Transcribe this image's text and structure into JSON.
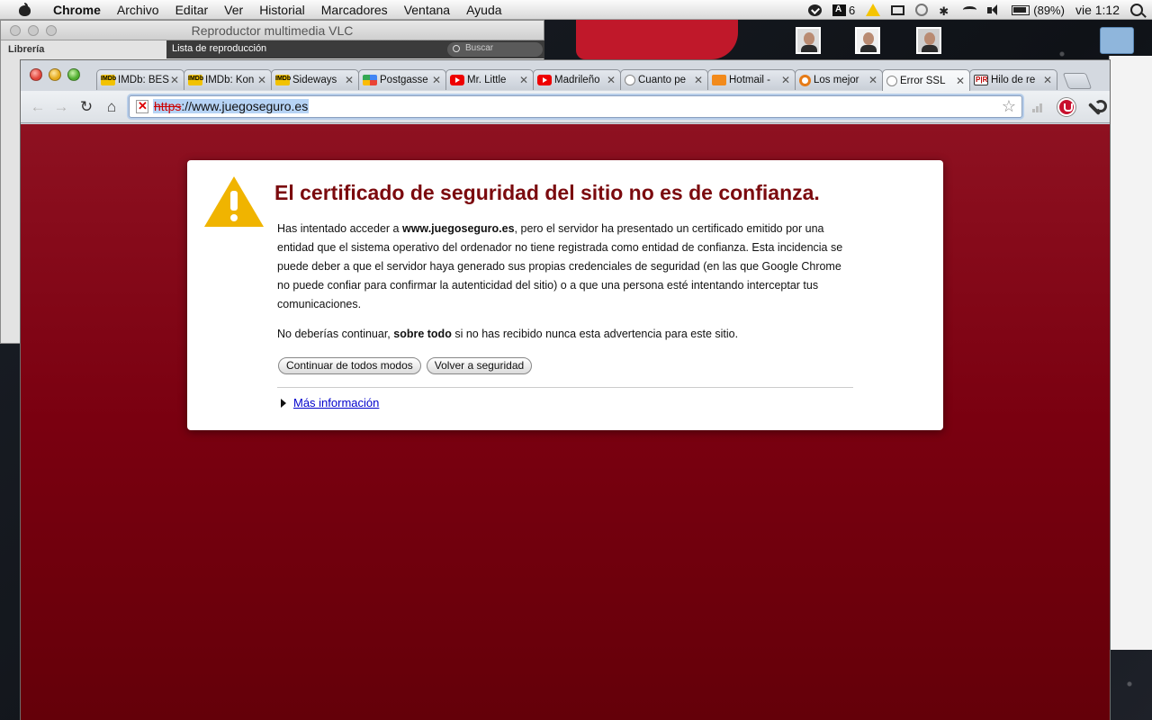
{
  "menubar": {
    "app_name": "Chrome",
    "items": [
      "Archivo",
      "Editar",
      "Ver",
      "Historial",
      "Marcadores",
      "Ventana",
      "Ayuda"
    ],
    "adobe_count": "6",
    "battery": "(89%)",
    "clock": "vie 1:12"
  },
  "vlc": {
    "title": "Reproductor multimedia VLC",
    "library_label": "Librería",
    "playlist_tab": "Lista de reproducción",
    "search_placeholder": "Buscar"
  },
  "browser": {
    "tabs": [
      {
        "label": "IMDb: BEST",
        "icon": "imdb-icon"
      },
      {
        "label": "IMDb: Kon",
        "icon": "imdb-icon"
      },
      {
        "label": "Sideways",
        "icon": "imdb-icon"
      },
      {
        "label": "Postgasse",
        "icon": "google-icon"
      },
      {
        "label": "Mr. Little",
        "icon": "youtube-icon"
      },
      {
        "label": "Madrileño",
        "icon": "youtube-icon"
      },
      {
        "label": "Cuanto pe",
        "icon": "globe-icon"
      },
      {
        "label": "Hotmail -",
        "icon": "mail-icon"
      },
      {
        "label": "Los mejor",
        "icon": "ring-icon"
      },
      {
        "label": "Error SSL",
        "icon": "globe-icon",
        "active": true
      },
      {
        "label": "Hilo de re",
        "icon": "pr-icon"
      }
    ],
    "url_scheme": "https",
    "url_rest": "://www.juegoseguro.es"
  },
  "error_page": {
    "title": "El certificado de seguridad del sitio no es de confianza.",
    "para1_pre": "Has intentado acceder a ",
    "para1_domain": "www.juegoseguro.es",
    "para1_post": ", pero el servidor ha presentado un certificado emitido por una entidad que el sistema operativo del ordenador no tiene registrada como entidad de confianza. Esta incidencia se puede deber a que el servidor haya generado sus propias credenciales de seguridad (en las que Google Chrome no puede confiar para confirmar la autenticidad del sitio) o a que una persona esté intentando interceptar tus comunicaciones.",
    "para2_pre": "No deberías continuar, ",
    "para2_bold": "sobre todo",
    "para2_post": " si no has recibido nunca esta advertencia para este sitio.",
    "continue_button": "Continuar de todos modos",
    "back_button": "Volver a seguridad",
    "more_info_link": "Más información"
  },
  "colors": {
    "error_background": "#7a0010",
    "title_color": "#7b0a0e",
    "link_color": "#0000cc"
  }
}
